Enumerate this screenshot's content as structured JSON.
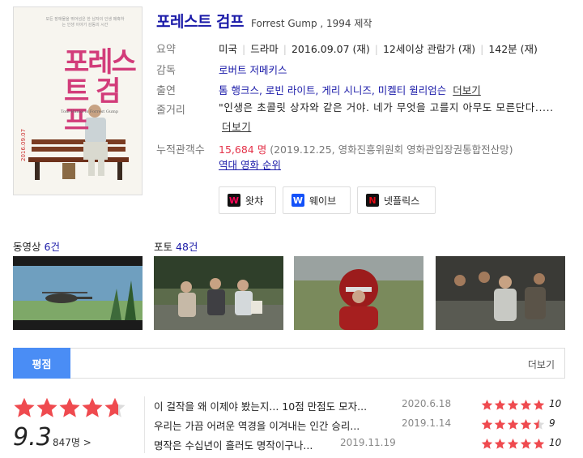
{
  "poster": {
    "title": "포레스트 검프",
    "top_text": "모든 장애물을 뛰어넘은 한 남자의 인생 매혹하는 인생 이야기 감동의 시간",
    "sub_text": "Tom Hanks is Forrest Gump",
    "date_text": "2016.09.07"
  },
  "movie": {
    "title": "포레스트 검프",
    "subtitle": "Forrest Gump , 1994 제작"
  },
  "info": {
    "summary_label": "요약",
    "summary": [
      "미국",
      "드라마",
      "2016.09.07 (재)",
      "12세이상 관람가 (재)",
      "142분 (재)"
    ],
    "director_label": "감독",
    "director": "로버트 저메키스",
    "cast_label": "출연",
    "cast": "톰 행크스, 로빈 라이트, 게리 시니즈, 미켈티 윌리엄슨",
    "cast_more": "더보기",
    "plot_label": "줄거리",
    "plot": "\"인생은 초콜릿 상자와 같은 거야. 네가 무엇을 고를지 아무도 모른단다.....",
    "plot_more": "더보기",
    "audience_label": "누적관객수",
    "audience_count": "15,684 명",
    "audience_source": "(2019.12.25, 영화진흥위원회 영화관입장권통합전산망)",
    "ranking_link": "역대 영화 순위"
  },
  "streaming": [
    {
      "name": "왓챠",
      "icon": "watcha-icon",
      "color": "#ff0558",
      "letter": "W"
    },
    {
      "name": "웨이브",
      "icon": "wavve-icon",
      "color": "#1351f9",
      "letter": "W"
    },
    {
      "name": "넷플릭스",
      "icon": "netflix-icon",
      "color": "#e50914",
      "letter": "N"
    }
  ],
  "media": {
    "video_label": "동영상",
    "video_count": "6건",
    "photo_label": "포토",
    "photo_count": "48건"
  },
  "ratings": {
    "tab_label": "평점",
    "more_label": "더보기",
    "average": "9.3",
    "average_stars": 4.65,
    "count": "847명 >",
    "reviews": [
      {
        "text": "이 걸작을 왜 이제야 봤는지... 10점 만점도 모자...",
        "date": "2020.6.18",
        "score": "10",
        "stars": 5
      },
      {
        "text": "우리는 가끔 어려운 역경을 이겨내는 인간 승리...",
        "date": "2019.1.14",
        "score": "9",
        "stars": 4.5
      },
      {
        "text": "명작은 수십년이 흘러도 명작이구나...",
        "date": "2019.11.19",
        "score": "10",
        "stars": 5
      }
    ]
  }
}
